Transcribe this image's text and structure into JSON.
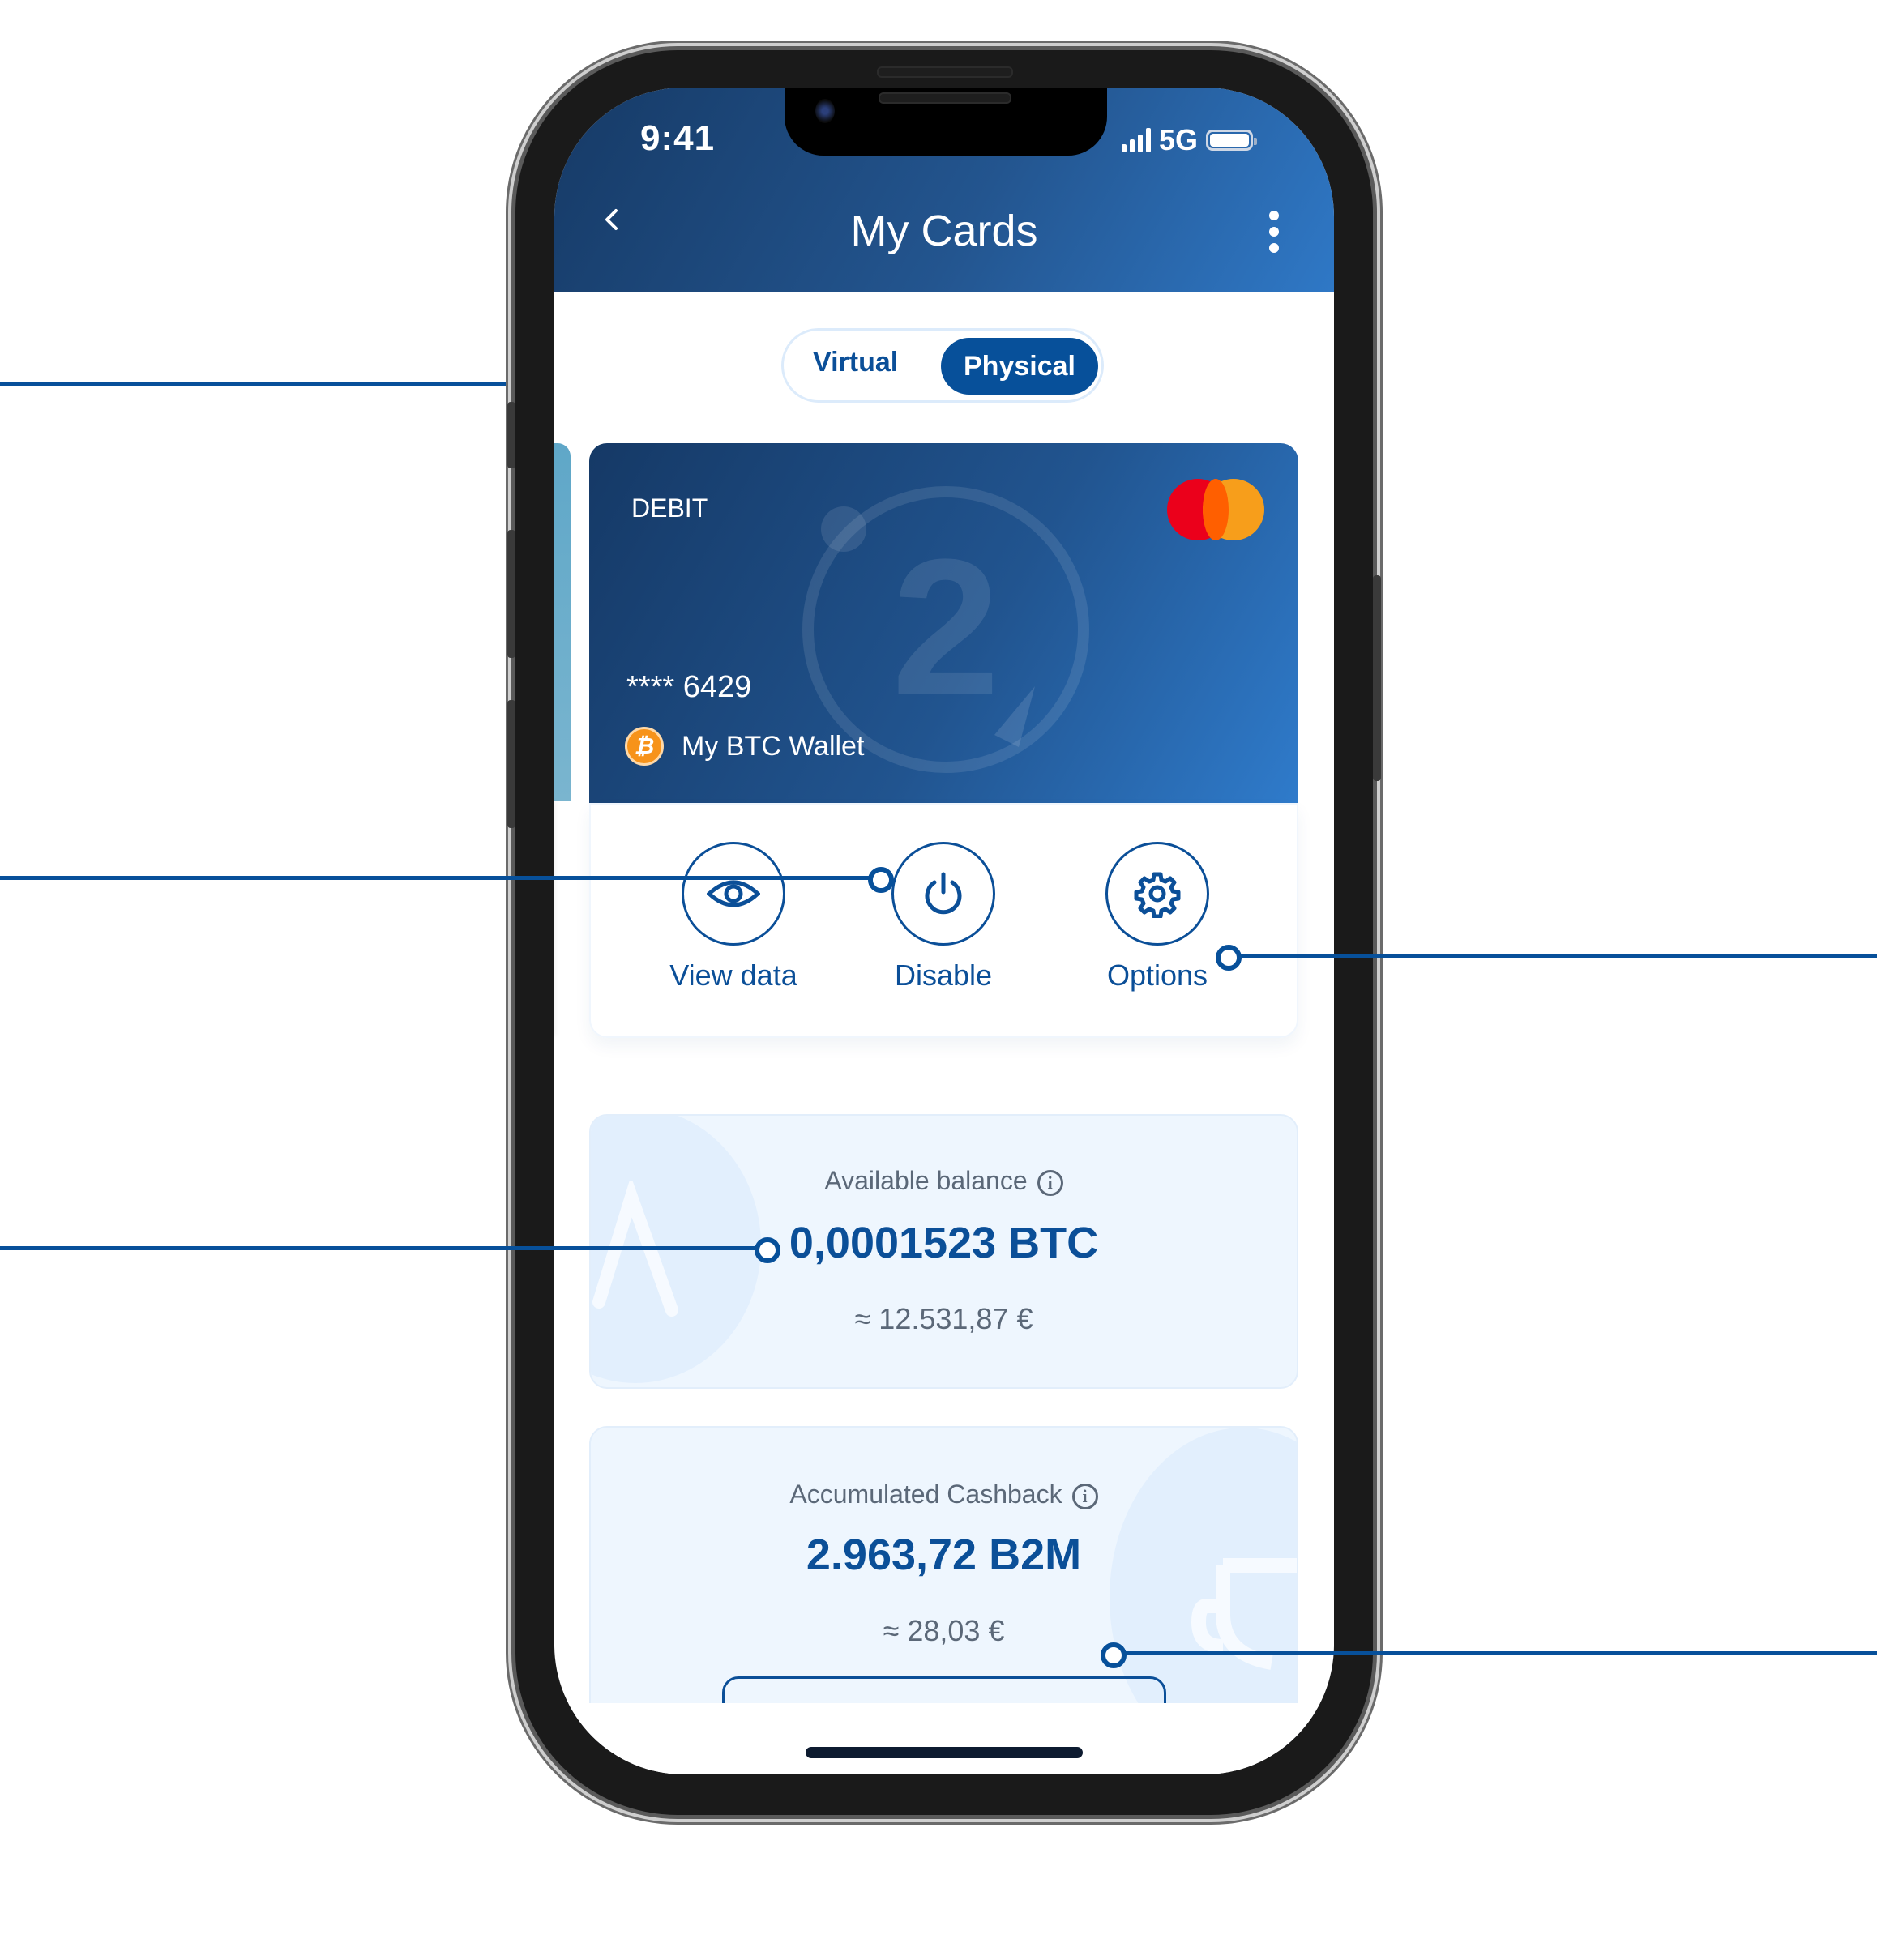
{
  "status_bar": {
    "time": "9:41",
    "network": "5G",
    "signal_icon": "signal-bars-icon",
    "battery_icon": "battery-full-icon"
  },
  "header": {
    "title": "My Cards",
    "back_icon": "chevron-left-icon",
    "menu_icon": "kebab-menu-icon"
  },
  "card_type_toggle": {
    "options": [
      "Virtual",
      "Physical"
    ],
    "selected": "Physical"
  },
  "card": {
    "type": "DEBIT",
    "masked_number": "**** 6429",
    "wallet_name": "My BTC Wallet",
    "wallet_icon": "bitcoin-icon",
    "brand_icon": "mastercard-logo-icon",
    "watermark_digit": "2",
    "colors": {
      "gradient_start": "#153966",
      "gradient_end": "#2f7bcb"
    }
  },
  "card_actions": [
    {
      "label": "View data",
      "icon": "eye-icon"
    },
    {
      "label": "Disable",
      "icon": "power-icon"
    },
    {
      "label": "Options",
      "icon": "gear-icon"
    }
  ],
  "available_balance": {
    "label": "Available balance",
    "value": "0,0001523 BTC",
    "fiat": "≈ 12.531,87 €",
    "info_icon": "info-icon"
  },
  "cashback": {
    "label": "Accumulated Cashback",
    "value": "2.963,72 B2M",
    "fiat": "≈ 28,03 €",
    "info_icon": "info-icon"
  },
  "colors": {
    "accent": "#07509a",
    "header_gradient_start": "#163a66",
    "header_gradient_end": "#2f78c6",
    "box_background": "#eef6fe",
    "muted_text": "#5b6878"
  }
}
